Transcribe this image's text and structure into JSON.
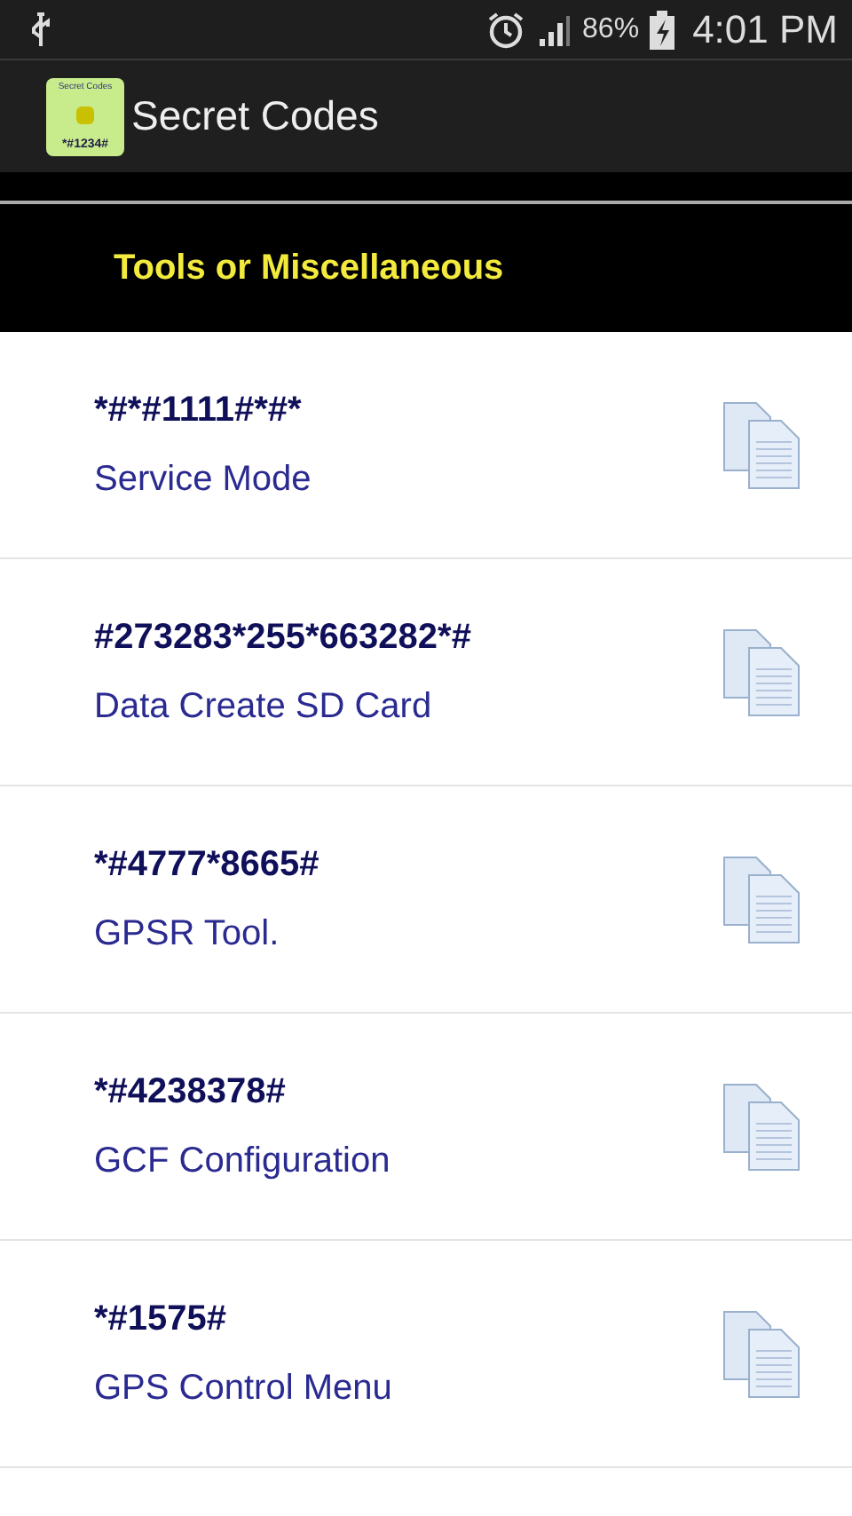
{
  "status_bar": {
    "battery": "86%",
    "time": "4:01 PM"
  },
  "app_bar": {
    "icon_title": "Secret Codes",
    "icon_code": "*#1234#",
    "title": "Secret Codes"
  },
  "section": {
    "title": "Tools or Miscellaneous"
  },
  "codes": [
    {
      "code": "*#*#1111#*#*",
      "name": "Service Mode"
    },
    {
      "code": "#273283*255*663282*#",
      "name": "Data Create SD Card"
    },
    {
      "code": "*#4777*8665#",
      "name": "GPSR Tool."
    },
    {
      "code": "*#4238378#",
      "name": "GCF Configuration"
    },
    {
      "code": "*#1575#",
      "name": "GPS Control Menu"
    }
  ]
}
